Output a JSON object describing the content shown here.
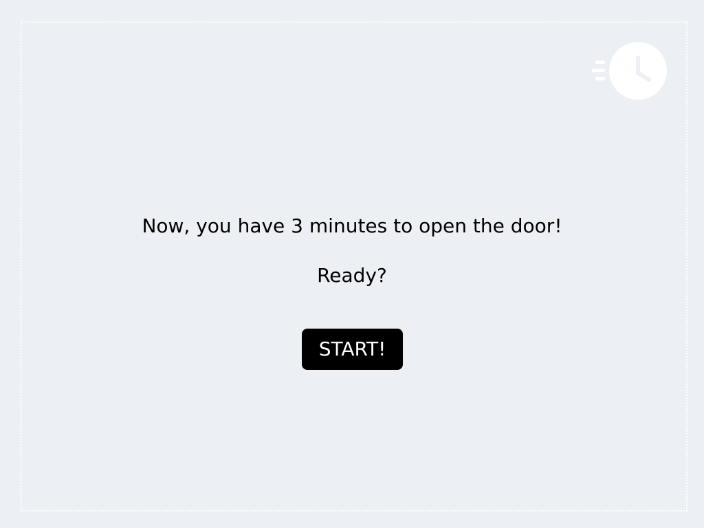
{
  "screen": {
    "message": "Now, you have 3 minutes to open the door!",
    "prompt": "Ready?",
    "start_label": "START!"
  },
  "icons": {
    "timer": "fast-clock-icon"
  },
  "colors": {
    "background": "#eceff4",
    "button_bg": "#000000",
    "button_text": "#ffffff",
    "icon": "#ffffff",
    "text": "#000000"
  }
}
